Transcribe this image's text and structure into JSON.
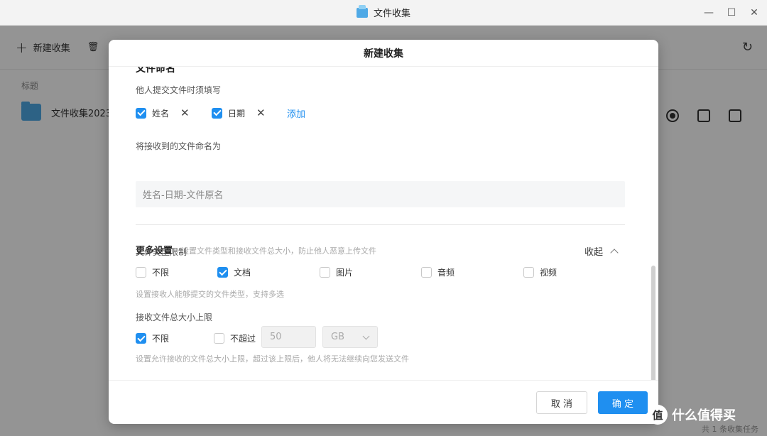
{
  "window": {
    "title": "文件收集"
  },
  "toolbar": {
    "new_label": "新建收集"
  },
  "list": {
    "header": "标题",
    "rows": [
      {
        "name": "文件收集2023"
      }
    ]
  },
  "status": "共 1 条收集任务",
  "dialog": {
    "title": "新建收集",
    "cut_heading": "文件命名",
    "required_label": "他人提交文件时须填写",
    "required_fields": [
      {
        "label": "姓名",
        "checked": true
      },
      {
        "label": "日期",
        "checked": true
      }
    ],
    "add_link": "添加",
    "rename_label": "将接收到的文件命名为",
    "rename_value": "姓名-日期-文件原名",
    "more": {
      "title": "更多设置",
      "desc": "设置文件类型和接收文件总大小，防止他人恶意上传文件",
      "toggle": "收起"
    },
    "type_limit": {
      "label": "文件类型限制",
      "options": [
        {
          "label": "不限",
          "checked": false
        },
        {
          "label": "文档",
          "checked": true
        },
        {
          "label": "图片",
          "checked": false
        },
        {
          "label": "音频",
          "checked": false
        },
        {
          "label": "视频",
          "checked": false
        }
      ],
      "hint": "设置接收人能够提交的文件类型，支持多选"
    },
    "size_limit": {
      "label": "接收文件总大小上限",
      "unlimited": {
        "label": "不限",
        "checked": true
      },
      "max": {
        "label": "不超过",
        "checked": false
      },
      "value": "50",
      "unit": "GB",
      "hint": "设置允许接收的文件总大小上限，超过该上限后，他人将无法继续向您发送文件"
    },
    "cancel": "取 消",
    "ok": "确 定"
  },
  "watermark": {
    "badge": "值",
    "text": "什么值得买"
  },
  "colors": {
    "accent": "#1f8ff0",
    "folder": "#4fa9e6"
  }
}
